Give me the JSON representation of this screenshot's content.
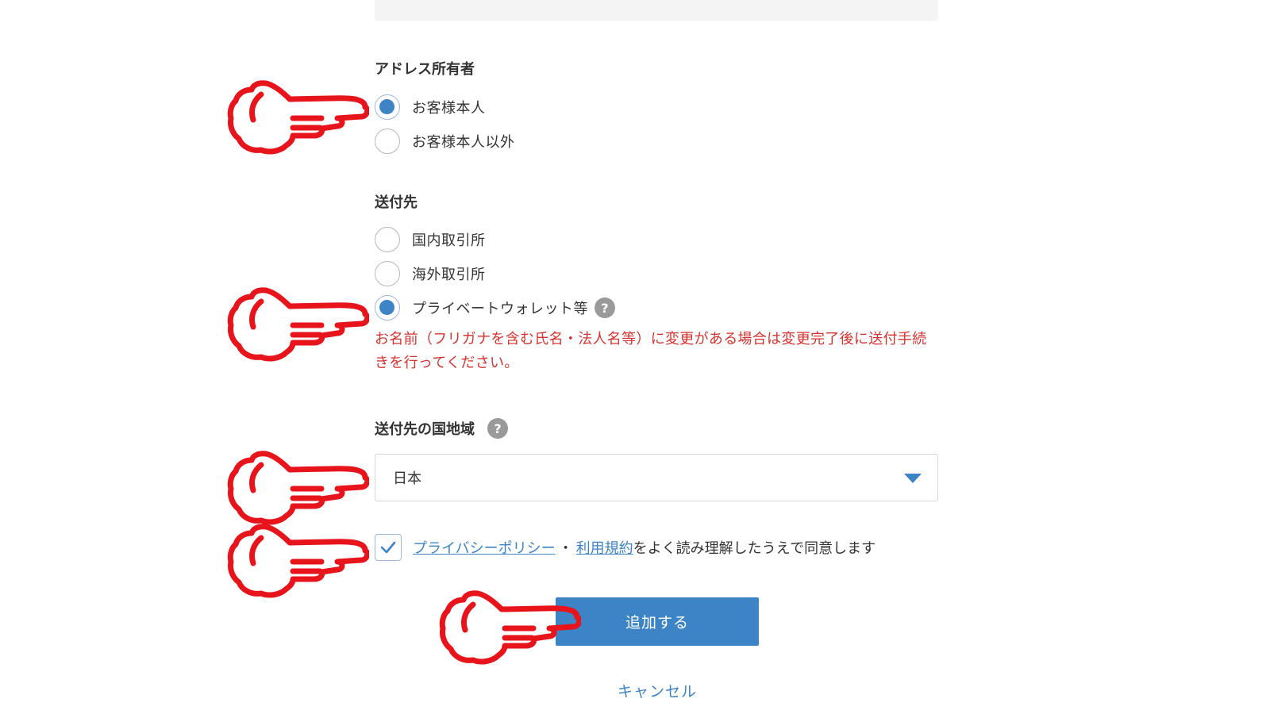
{
  "address_owner": {
    "title": "アドレス所有者",
    "options": [
      {
        "label": "お客様本人",
        "selected": true
      },
      {
        "label": "お客様本人以外",
        "selected": false
      }
    ]
  },
  "destination": {
    "title": "送付先",
    "options": [
      {
        "label": "国内取引所",
        "selected": false
      },
      {
        "label": "海外取引所",
        "selected": false
      },
      {
        "label": "プライベートウォレット等",
        "selected": true
      }
    ],
    "help": "?",
    "warning": "お名前（フリガナを含む氏名・法人名等）に変更がある場合は変更完了後に送付手続きを行ってください。"
  },
  "country": {
    "title": "送付先の国地域",
    "help": "?",
    "selected_value": "日本"
  },
  "consent": {
    "checked": true,
    "privacy_link": "プライバシーポリシー",
    "separator": "・",
    "terms_link": "利用規約",
    "text": "をよく読み理解したうえで同意します"
  },
  "actions": {
    "submit_label": "追加する",
    "cancel_label": "キャンセル"
  },
  "colors": {
    "accent": "#3d84c6",
    "warning": "#d5332f",
    "annotation": "#e8141b"
  },
  "icons": {
    "pointer": "pointing-hand-icon",
    "help": "question-mark-icon",
    "check": "checkmark-icon",
    "dropdown": "caret-down-icon"
  }
}
